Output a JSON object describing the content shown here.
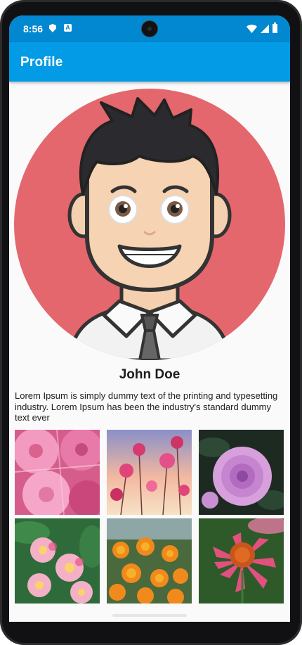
{
  "status_bar": {
    "time": "8:56",
    "left_icons": [
      "shield-icon",
      "a-badge-icon"
    ],
    "right_icons": [
      "wifi-icon",
      "signal-icon",
      "battery-icon"
    ],
    "a_badge_text": "A"
  },
  "app_bar": {
    "title": "Profile",
    "background": "#039be5"
  },
  "profile": {
    "name": "John Doe",
    "bio": "Lorem Ipsum is simply dummy text of the printing and typesetting industry. Lorem Ipsum has been the industry's standard dummy text ever",
    "avatar_background": "#e4676d"
  },
  "gallery": {
    "items": [
      {
        "subject": "pink-dahlia-closeup"
      },
      {
        "subject": "pink-cosmos-against-sky"
      },
      {
        "subject": "lilac-dahlia-dark-background"
      },
      {
        "subject": "pink-plumeria-cluster"
      },
      {
        "subject": "orange-marigolds"
      },
      {
        "subject": "pink-echinacea"
      }
    ]
  }
}
